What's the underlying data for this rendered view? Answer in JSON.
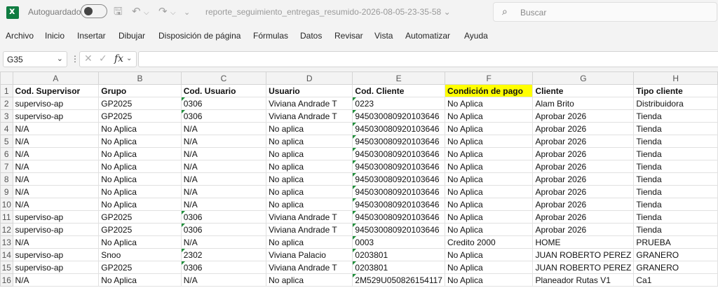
{
  "titlebar": {
    "autosave_label": "Autoguardado",
    "document_title": "reporte_seguimiento_entregas_resumido-2026-08-05-23-35-58",
    "title_caret": "⌄",
    "search_placeholder": "Buscar"
  },
  "menu": [
    "Archivo",
    "Inicio",
    "Insertar",
    "Dibujar",
    "Disposición de página",
    "Fórmulas",
    "Datos",
    "Revisar",
    "Vista",
    "Automatizar",
    "Ayuda"
  ],
  "formula_bar": {
    "name_box": "G35",
    "formula": ""
  },
  "columns": [
    "A",
    "B",
    "C",
    "D",
    "E",
    "F",
    "G",
    "H"
  ],
  "rows": [
    {
      "n": "1",
      "cells": [
        "Cod. Supervisor",
        "Grupo",
        "Cod. Usuario",
        "Usuario",
        "Cod. Cliente",
        "Condición de pago",
        "Cliente",
        "Tipo cliente"
      ]
    },
    {
      "n": "2",
      "cells": [
        "superviso-ap",
        "GP2025",
        "0306",
        "Viviana Andrade T",
        "0223",
        "No Aplica",
        "Alam Brito",
        "Distribuidora"
      ]
    },
    {
      "n": "3",
      "cells": [
        "superviso-ap",
        "GP2025",
        "0306",
        "Viviana Andrade T",
        "94503008092010364​6",
        "No Aplica",
        "Aprobar 2026",
        "Tienda"
      ]
    },
    {
      "n": "4",
      "cells": [
        "N/A",
        "No Aplica",
        "N/A",
        "No aplica",
        "945030080920103646",
        "No Aplica",
        "Aprobar 2026",
        "Tienda"
      ]
    },
    {
      "n": "5",
      "cells": [
        "N/A",
        "No Aplica",
        "N/A",
        "No aplica",
        "945030080920103646",
        "No Aplica",
        "Aprobar 2026",
        "Tienda"
      ]
    },
    {
      "n": "6",
      "cells": [
        "N/A",
        "No Aplica",
        "N/A",
        "No aplica",
        "945030080920103646",
        "No Aplica",
        "Aprobar 2026",
        "Tienda"
      ]
    },
    {
      "n": "7",
      "cells": [
        "N/A",
        "No Aplica",
        "N/A",
        "No aplica",
        "945030080920103646",
        "No Aplica",
        "Aprobar 2026",
        "Tienda"
      ]
    },
    {
      "n": "8",
      "cells": [
        "N/A",
        "No Aplica",
        "N/A",
        "No aplica",
        "945030080920103646",
        "No Aplica",
        "Aprobar 2026",
        "Tienda"
      ]
    },
    {
      "n": "9",
      "cells": [
        "N/A",
        "No Aplica",
        "N/A",
        "No aplica",
        "945030080920103646",
        "No Aplica",
        "Aprobar 2026",
        "Tienda"
      ]
    },
    {
      "n": "10",
      "cells": [
        "N/A",
        "No Aplica",
        "N/A",
        "No aplica",
        "945030080920103646",
        "No Aplica",
        "Aprobar 2026",
        "Tienda"
      ]
    },
    {
      "n": "11",
      "cells": [
        "superviso-ap",
        "GP2025",
        "0306",
        "Viviana Andrade T",
        "945030080920103646",
        "No Aplica",
        "Aprobar 2026",
        "Tienda"
      ]
    },
    {
      "n": "12",
      "cells": [
        "superviso-ap",
        "GP2025",
        "0306",
        "Viviana Andrade T",
        "945030080920103646",
        "No Aplica",
        "Aprobar 2026",
        "Tienda"
      ]
    },
    {
      "n": "13",
      "cells": [
        "N/A",
        "No Aplica",
        "N/A",
        "No aplica",
        "0003",
        "Credito 2000",
        "HOME",
        "PRUEBA"
      ]
    },
    {
      "n": "14",
      "cells": [
        "superviso-ap",
        "Snoo",
        "2302",
        "Viviana Palacio",
        "0203801",
        "No Aplica",
        "JUAN ROBERTO PEREZ",
        "GRANERO"
      ]
    },
    {
      "n": "15",
      "cells": [
        "superviso-ap",
        "GP2025",
        "0306",
        "Viviana Andrade T",
        "0203801",
        "No Aplica",
        "JUAN ROBERTO PEREZ",
        "GRANERO"
      ]
    },
    {
      "n": "16",
      "cells": [
        "N/A",
        "No Aplica",
        "N/A",
        "No aplica",
        "2M529U050826154117",
        "No Aplica",
        "Planeador Rutas V1",
        "Ca1"
      ]
    }
  ],
  "colors": {
    "header_highlight": "#ffff00",
    "excel_green": "#107c41",
    "error_indicator": "#1f8f3a"
  }
}
